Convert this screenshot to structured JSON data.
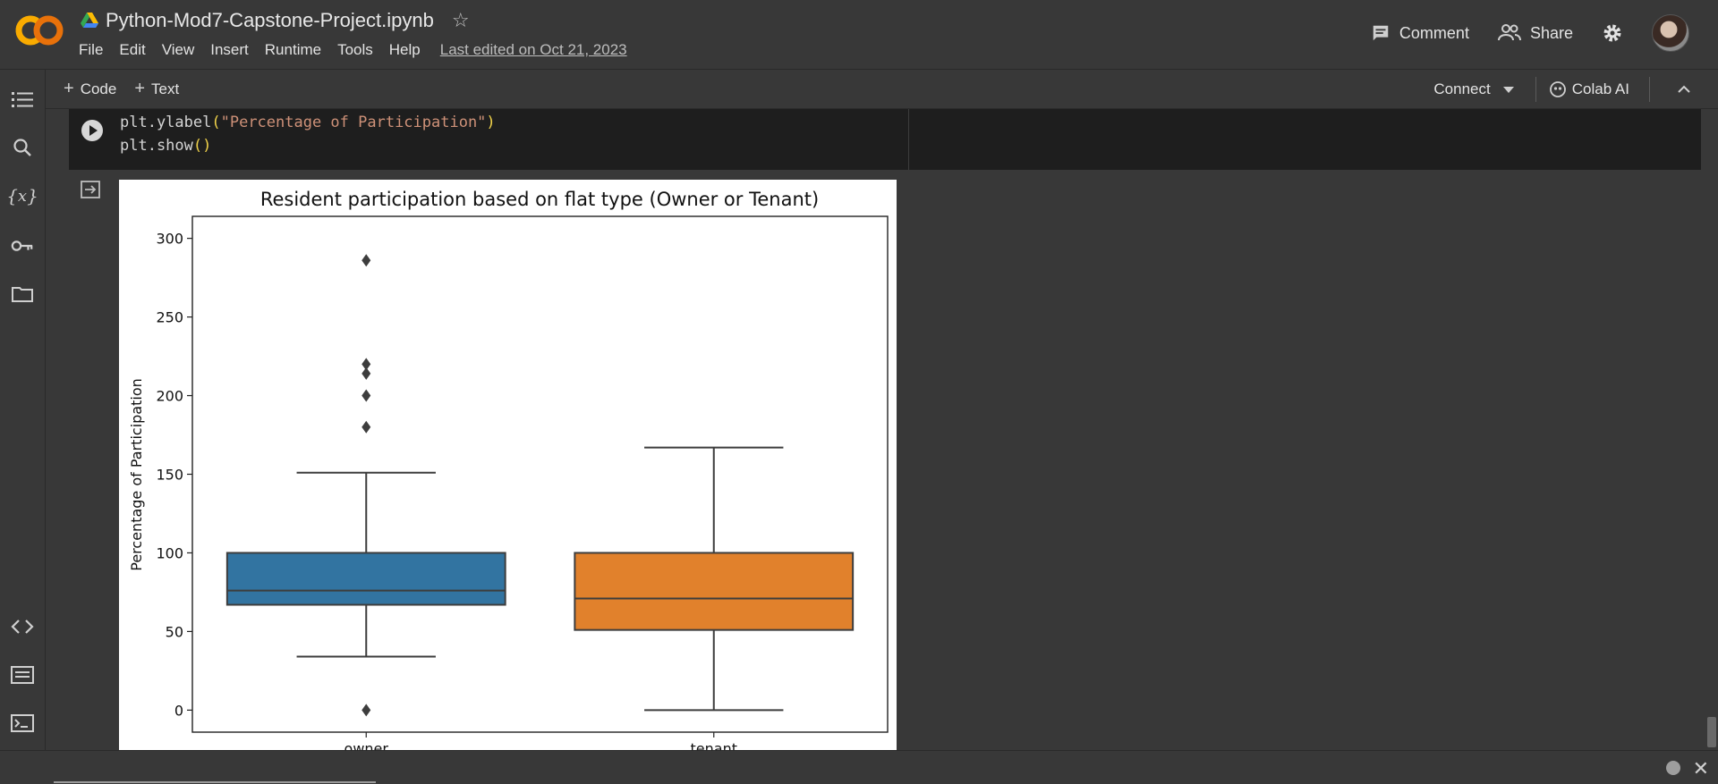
{
  "header": {
    "notebook_title": "Python-Mod7-Capstone-Project.ipynb",
    "menu": [
      "File",
      "Edit",
      "View",
      "Insert",
      "Runtime",
      "Tools",
      "Help"
    ],
    "last_edited": "Last edited on Oct 21, 2023",
    "comment_label": "Comment",
    "share_label": "Share"
  },
  "toolbar": {
    "add_code_label": "Code",
    "add_text_label": "Text",
    "connect_label": "Connect",
    "colab_ai_label": "Colab AI"
  },
  "code": {
    "line1_fn": "plt.ylabel",
    "line1_arg": "\"Percentage of Participation\"",
    "line2_fn": "plt.show",
    "open_paren": "(",
    "close_paren": ")",
    "empty_parens": "()"
  },
  "colors": {
    "owner_box": "#3274a1",
    "tenant_box": "#e1812c",
    "accent_logo_orange": "#f9ab00",
    "accent_logo_yellow": "#e8710a"
  },
  "chart_data": {
    "type": "box",
    "title": "Resident participation based on flat type (Owner or Tenant)",
    "xlabel": "",
    "ylabel": "Percentage of Participation",
    "categories": [
      "owner",
      "tenant"
    ],
    "ylim": [
      -14,
      314
    ],
    "yticks": [
      0,
      50,
      100,
      150,
      200,
      250,
      300
    ],
    "boxes": [
      {
        "name": "owner",
        "whisker_low": 34,
        "q1": 67,
        "median": 76,
        "q3": 100,
        "whisker_high": 151,
        "outliers": [
          0,
          180,
          200,
          214,
          220,
          286
        ]
      },
      {
        "name": "tenant",
        "whisker_low": 0,
        "q1": 51,
        "median": 71,
        "q3": 100,
        "whisker_high": 167,
        "outliers": []
      }
    ],
    "grid": false
  }
}
